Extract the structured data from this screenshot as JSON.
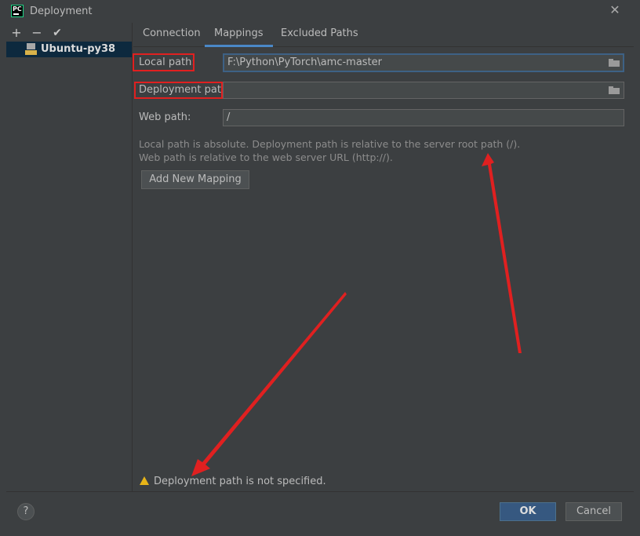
{
  "window": {
    "app_icon_text": "PC",
    "title": "Deployment",
    "close_icon": "close-icon"
  },
  "sidebar": {
    "toolbar": {
      "add": "+",
      "remove": "−",
      "apply": "✔"
    },
    "servers": [
      {
        "label": "Ubuntu-py38",
        "icon": "sftp-server-icon"
      }
    ]
  },
  "tabs": [
    {
      "label": "Connection",
      "active": false
    },
    {
      "label": "Mappings",
      "active": true
    },
    {
      "label": "Excluded Paths",
      "active": false
    }
  ],
  "mapping": {
    "local_label": "Local path:",
    "local_value": "F:\\Python\\PyTorch\\amc-master",
    "deployment_label": "Deployment path:",
    "deployment_value": "",
    "web_label": "Web path:",
    "web_value": "/",
    "hint_line1": "Local path is absolute. Deployment path is relative to the server root path (/).",
    "hint_line2": "Web path is relative to the web server URL (http://).",
    "add_button": "Add New Mapping"
  },
  "warning": {
    "text": "Deployment path is not specified.",
    "icon": "warning-icon",
    "color": "#e7b418"
  },
  "buttons": {
    "help": "?",
    "ok": "OK",
    "cancel": "Cancel"
  },
  "colors": {
    "accent": "#4a88c7",
    "annotation": "#e02020",
    "ok_bg": "#365880"
  }
}
